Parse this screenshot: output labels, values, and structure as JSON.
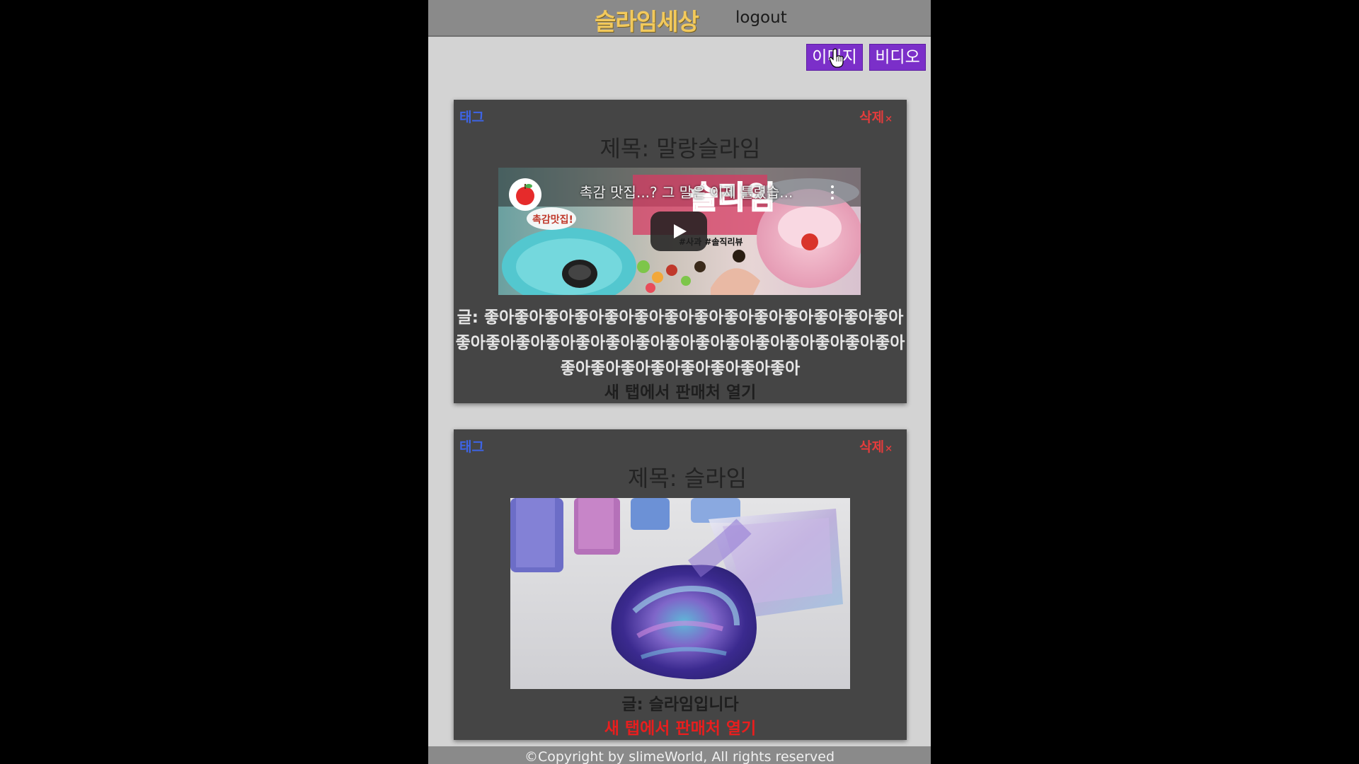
{
  "header": {
    "brand": "슬라임세상",
    "logout_label": "logout"
  },
  "filters": {
    "image_label": "이미지",
    "video_label": "비디오"
  },
  "posts": [
    {
      "tag_label": "태그",
      "delete_label": "삭제",
      "delete_icon": "×",
      "title": "제목: 말랑슬라임",
      "media_type": "video",
      "video_title": "촉감 맛집...? 그 말은 이제 틀렸습...",
      "video_hashtags": "#사과 #솔직리뷰",
      "body": "글: 좋아좋아좋아좋아좋아좋아좋아좋아좋아좋아좋아좋아좋아좋아좋아좋아좋아좋아좋아좋아좋아좋아좋아좋아좋아좋아좋아좋아좋아좋아좋아좋아좋아좋아좋아좋아좋아",
      "link_label": "새 탭에서 판매처 열기"
    },
    {
      "tag_label": "태그",
      "delete_label": "삭제",
      "delete_icon": "×",
      "title": "제목: 슬라임",
      "media_type": "image",
      "body": "글: 슬라임입니다",
      "link_label": "새 탭에서 판매처 열기"
    }
  ],
  "footer": {
    "copyright": "©Copyright by slimeWorld, All rights reserved"
  },
  "colors": {
    "brand": "#f2c95c",
    "filter_button": "#7b2fc9",
    "tag": "#3d64e6",
    "delete": "#e23c3c",
    "link_active": "#e81e1e",
    "card_bg": "#454545",
    "page_bg": "#d3d3d3"
  }
}
